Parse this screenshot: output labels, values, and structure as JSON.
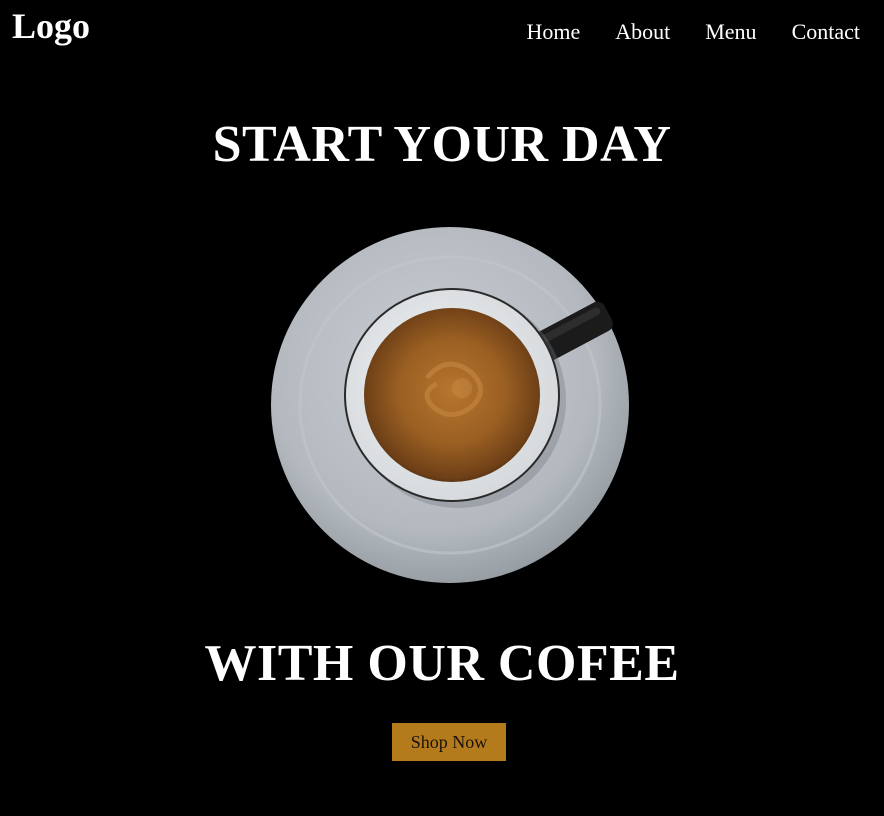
{
  "header": {
    "logo": "Logo",
    "nav": [
      "Home",
      "About",
      "Menu",
      "Contact"
    ]
  },
  "hero": {
    "headline_top": "START YOUR DAY",
    "headline_bottom": "WITH OUR COFEE",
    "cta_label": "Shop Now"
  },
  "colors": {
    "background": "#000000",
    "text": "#ffffff",
    "cta_background": "#b47b1c",
    "cta_text": "#1a1208"
  }
}
